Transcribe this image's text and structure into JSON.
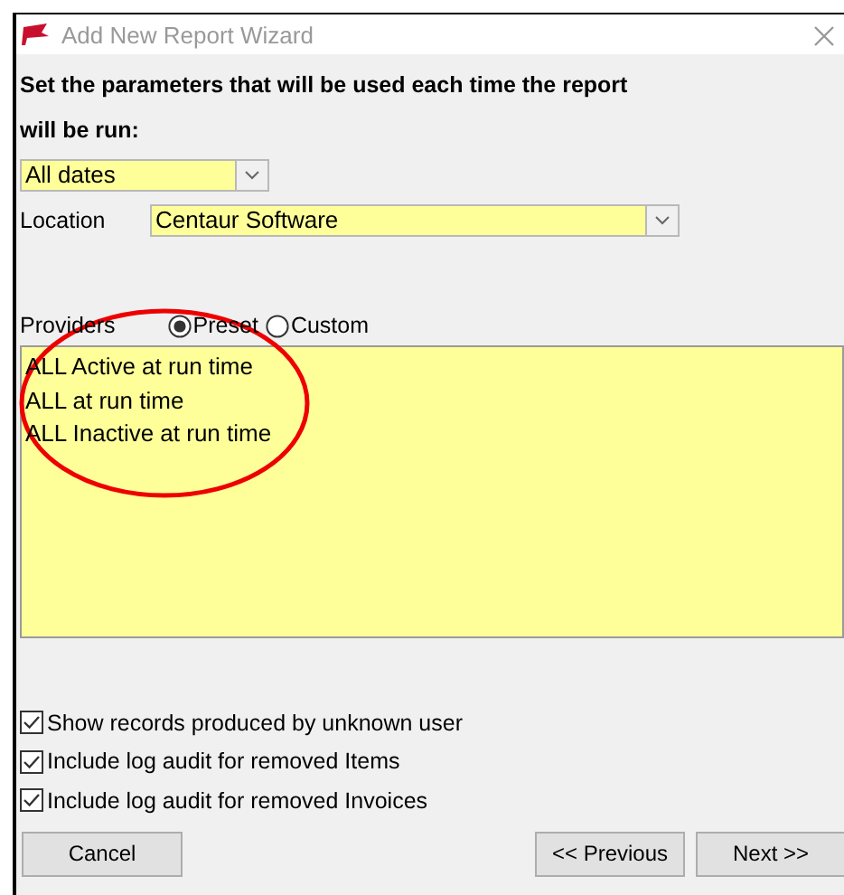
{
  "window": {
    "title": "Add New Report Wizard"
  },
  "instructions": [
    "Set the parameters that will be used each time the report",
    "will be run:"
  ],
  "date_range": {
    "value": "All dates"
  },
  "location": {
    "label": "Location",
    "value": "Centaur Software"
  },
  "providers": {
    "label": "Providers",
    "options": [
      {
        "label": "Preset",
        "selected": true
      },
      {
        "label": "Custom",
        "selected": false
      }
    ],
    "items": [
      "ALL Active at run time",
      "ALL at run time",
      "ALL Inactive at run time"
    ]
  },
  "options": [
    {
      "label": "Show records produced by unknown user",
      "checked": true
    },
    {
      "label": "Include log audit for removed Items",
      "checked": true
    },
    {
      "label": "Include log audit for removed Invoices",
      "checked": true
    }
  ],
  "buttons": {
    "cancel": "Cancel",
    "previous": "<< Previous",
    "next": "Next >>"
  }
}
